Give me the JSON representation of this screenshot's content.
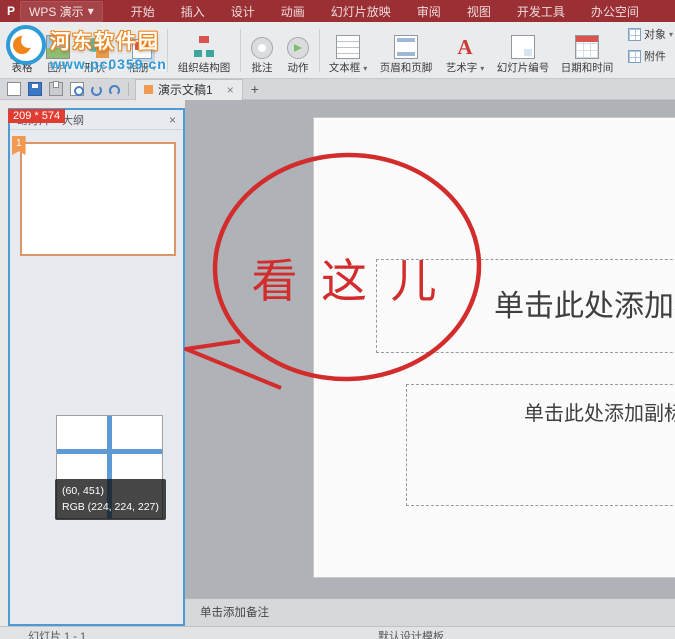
{
  "titlebar": {
    "logo": "P",
    "app_button": "WPS 演示",
    "app_arrow": "▾",
    "menus": [
      "开始",
      "插入",
      "设计",
      "动画",
      "幻灯片放映",
      "审阅",
      "视图",
      "开发工具",
      "办公空间"
    ]
  },
  "ribbon": {
    "wordart_glyph": "A",
    "buttons": [
      {
        "label": "表格"
      },
      {
        "label": "图片"
      },
      {
        "label": "形状",
        "arrow": "▾"
      },
      {
        "label": "相册",
        "arrow": "▾"
      },
      {
        "label": "组织结构图"
      },
      {
        "label": "批注"
      },
      {
        "label": "动作"
      },
      {
        "label": "文本框",
        "arrow": "▾"
      },
      {
        "label": "页眉和页脚"
      },
      {
        "label": "艺术字",
        "arrow": "▾"
      },
      {
        "label": "幻灯片编号"
      },
      {
        "label": "日期和时间"
      }
    ],
    "side_buttons": [
      {
        "label": "对象",
        "arrow": "▾"
      },
      {
        "label": "附件"
      }
    ]
  },
  "tabbar": {
    "doc_tab": "演示文稿1",
    "close": "×",
    "new_tab": "+"
  },
  "size_label": "209 * 574",
  "panel": {
    "tab_slides": "幻灯片",
    "tab_outline": "大纲",
    "close": "×",
    "slide_number": "1"
  },
  "picker": {
    "coords": "(60, 451)",
    "rgb": "RGB (224, 224, 227)"
  },
  "slide": {
    "title_placeholder": "单击此处添加标题",
    "subtitle_placeholder": "单击此处添加副标题"
  },
  "annotation": {
    "text": "看 这 儿"
  },
  "watermark": {
    "site": "河东软件园",
    "url": "www.pc0359.cn"
  },
  "notes_placeholder": "单击添加备注",
  "statusbar": {
    "slide_info": "幻灯片 1 - 1",
    "template": "默认设计模板"
  }
}
